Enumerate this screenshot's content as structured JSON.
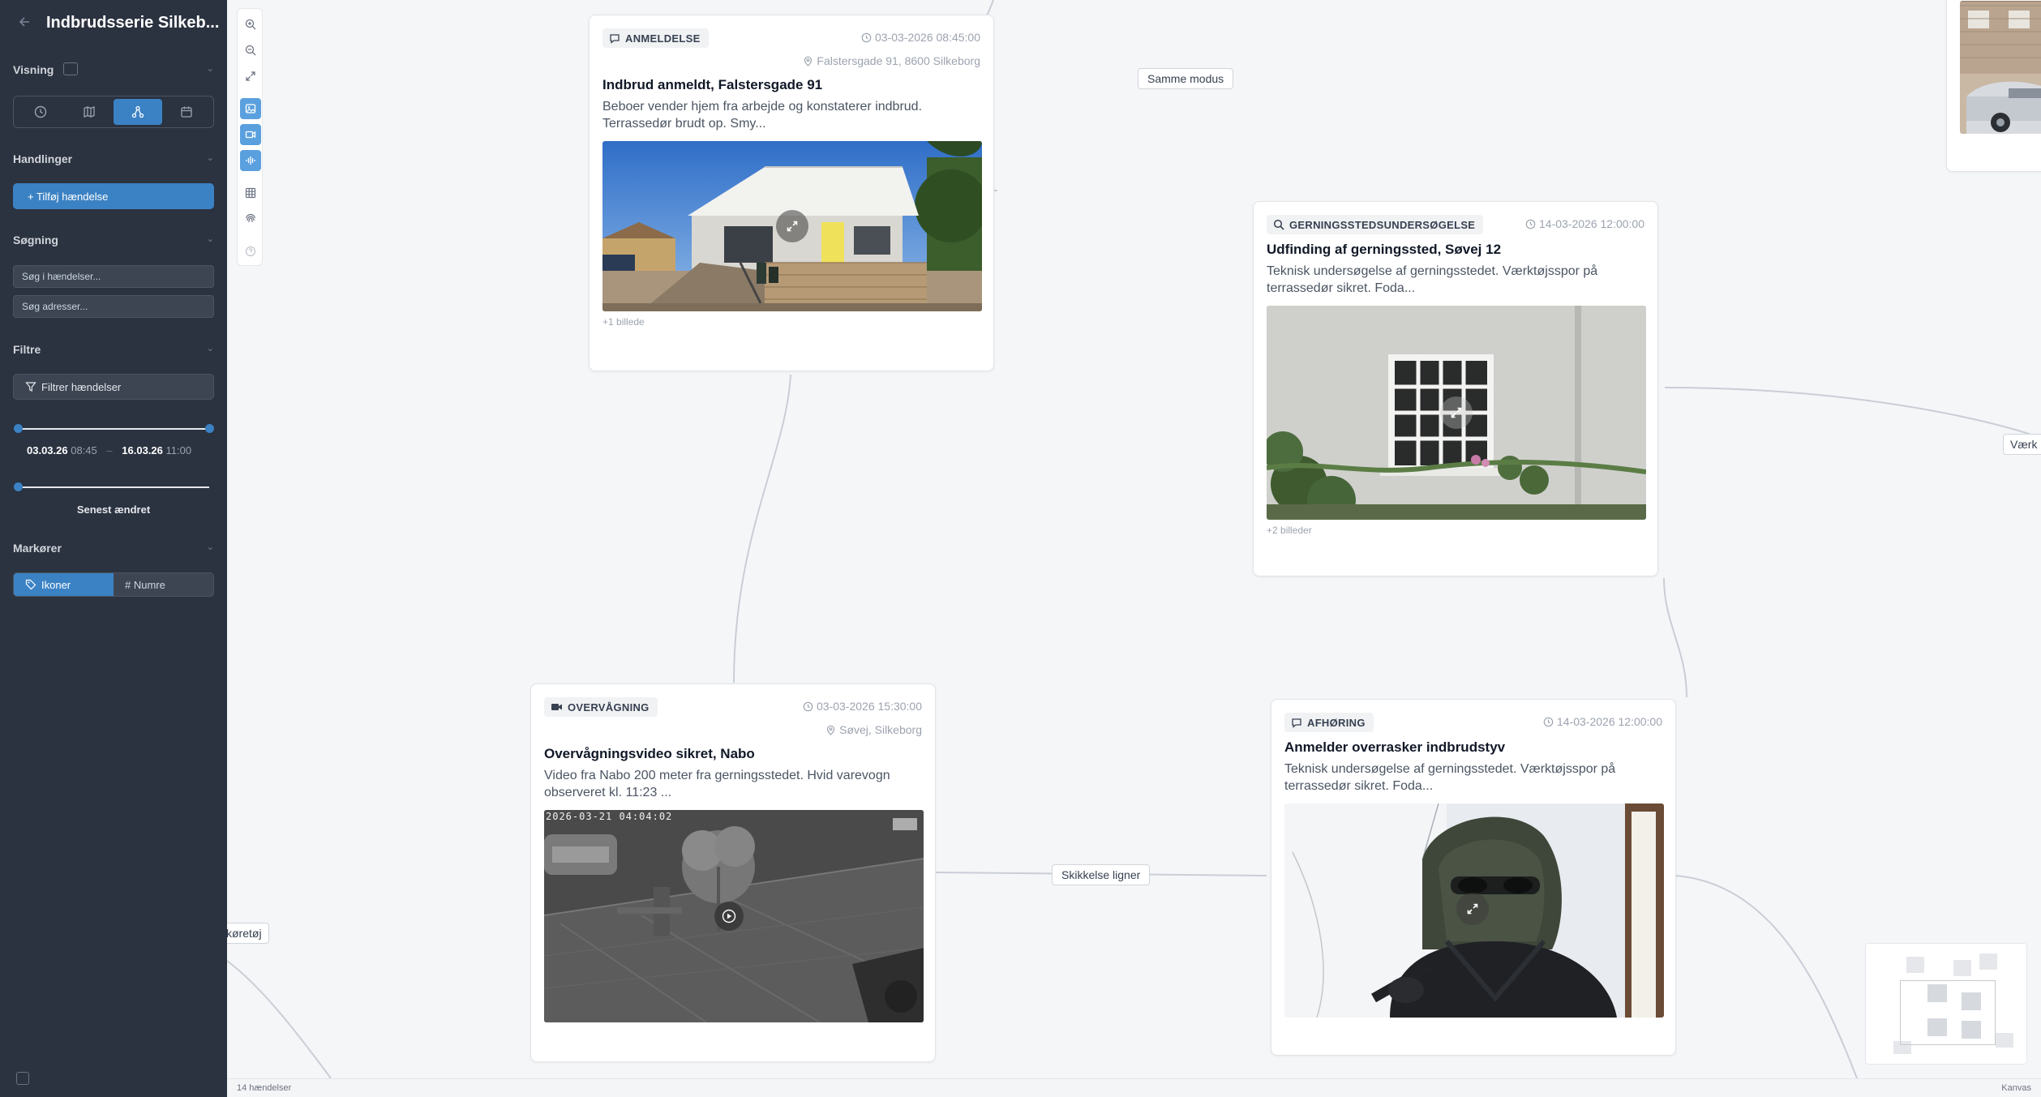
{
  "sidebar": {
    "title": "Indbrudsserie Silkeb...",
    "sections": {
      "view": "Visning",
      "actions": "Handlinger",
      "search": "Søgning",
      "filters": "Filtre",
      "markers": "Markører"
    },
    "add_event_label": "+ Tilføj hændelse",
    "search_events_placeholder": "Søg i hændelser...",
    "search_addresses_placeholder": "Søg adresser...",
    "filter_events_label": "Filtrer hændelser",
    "range": {
      "start_date": "03.03.26",
      "start_time": "08:45",
      "separator": "–",
      "end_date": "16.03.26",
      "end_time": "11:00",
      "start_fraction": 0.0,
      "end_fraction": 1.0
    },
    "sort_label": "Senest ændret",
    "markers": {
      "icons_label": "Ikoner",
      "numbers_label": "# Numre",
      "active": "icons"
    }
  },
  "canvas": {
    "edge_labels": {
      "same_mode": "Samme modus",
      "figure_similar": "Skikkelse ligner",
      "partial_right": "Værk",
      "partial_left": "køretøj"
    },
    "cards": {
      "report": {
        "badge": "ANMELDELSE",
        "time": "03-03-2026 08:45:00",
        "location": "Falstersgade 91, 8600 Silkeborg",
        "title": "Indbrud anmeldt, Falstersgade 91",
        "description": "Beboer vender hjem fra arbejde og konstaterer indbrud. Terrassedør brudt op. Smy...",
        "more": "+1 billede"
      },
      "investigation": {
        "badge": "GERNINGSSTEDSUNDERSØGELSE",
        "time": "14-03-2026 12:00:00",
        "title": "Udfinding af gerningssted, Søvej 12",
        "description": "Teknisk undersøgelse af gerningsstedet. Værktøjsspor på terrassedør sikret. Foda...",
        "more": "+2 billeder"
      },
      "surveillance": {
        "badge": "OVERVÅGNING",
        "time": "03-03-2026 15:30:00",
        "location": "Søvej, Silkeborg",
        "title": "Overvågningsvideo sikret, Nabo",
        "description": "Video fra Nabo 200 meter fra gerningsstedet. Hvid varevogn observeret kl. 11:23 ...",
        "video_timestamp": "2026-03-21 04:04:02"
      },
      "interview": {
        "badge": "AFHØRING",
        "time": "14-03-2026 12:00:00",
        "title": "Anmelder overrasker indbrudstyv",
        "description": "Teknisk undersøgelse af gerningsstedet. Værktøjsspor på terrassedør sikret. Foda..."
      }
    }
  },
  "statusbar": {
    "count": "14 hændelser",
    "mode": "Kanvas"
  },
  "colors": {
    "accent": "#3b82c4",
    "sidebar_bg": "#2b3240"
  }
}
